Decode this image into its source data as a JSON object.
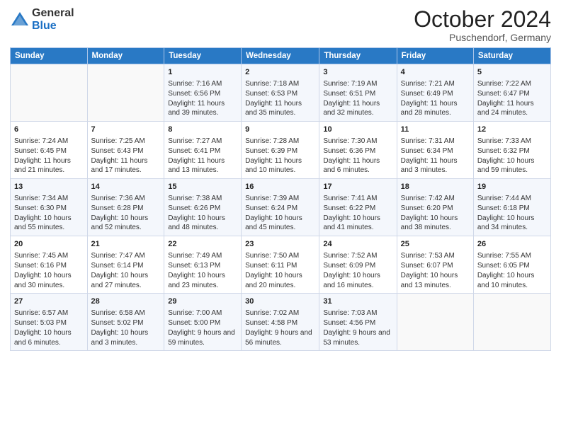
{
  "logo": {
    "general": "General",
    "blue": "Blue"
  },
  "title": "October 2024",
  "location": "Puschendorf, Germany",
  "days_header": [
    "Sunday",
    "Monday",
    "Tuesday",
    "Wednesday",
    "Thursday",
    "Friday",
    "Saturday"
  ],
  "weeks": [
    [
      {
        "day": "",
        "info": ""
      },
      {
        "day": "",
        "info": ""
      },
      {
        "day": "1",
        "info": "Sunrise: 7:16 AM\nSunset: 6:56 PM\nDaylight: 11 hours and 39 minutes."
      },
      {
        "day": "2",
        "info": "Sunrise: 7:18 AM\nSunset: 6:53 PM\nDaylight: 11 hours and 35 minutes."
      },
      {
        "day": "3",
        "info": "Sunrise: 7:19 AM\nSunset: 6:51 PM\nDaylight: 11 hours and 32 minutes."
      },
      {
        "day": "4",
        "info": "Sunrise: 7:21 AM\nSunset: 6:49 PM\nDaylight: 11 hours and 28 minutes."
      },
      {
        "day": "5",
        "info": "Sunrise: 7:22 AM\nSunset: 6:47 PM\nDaylight: 11 hours and 24 minutes."
      }
    ],
    [
      {
        "day": "6",
        "info": "Sunrise: 7:24 AM\nSunset: 6:45 PM\nDaylight: 11 hours and 21 minutes."
      },
      {
        "day": "7",
        "info": "Sunrise: 7:25 AM\nSunset: 6:43 PM\nDaylight: 11 hours and 17 minutes."
      },
      {
        "day": "8",
        "info": "Sunrise: 7:27 AM\nSunset: 6:41 PM\nDaylight: 11 hours and 13 minutes."
      },
      {
        "day": "9",
        "info": "Sunrise: 7:28 AM\nSunset: 6:39 PM\nDaylight: 11 hours and 10 minutes."
      },
      {
        "day": "10",
        "info": "Sunrise: 7:30 AM\nSunset: 6:36 PM\nDaylight: 11 hours and 6 minutes."
      },
      {
        "day": "11",
        "info": "Sunrise: 7:31 AM\nSunset: 6:34 PM\nDaylight: 11 hours and 3 minutes."
      },
      {
        "day": "12",
        "info": "Sunrise: 7:33 AM\nSunset: 6:32 PM\nDaylight: 10 hours and 59 minutes."
      }
    ],
    [
      {
        "day": "13",
        "info": "Sunrise: 7:34 AM\nSunset: 6:30 PM\nDaylight: 10 hours and 55 minutes."
      },
      {
        "day": "14",
        "info": "Sunrise: 7:36 AM\nSunset: 6:28 PM\nDaylight: 10 hours and 52 minutes."
      },
      {
        "day": "15",
        "info": "Sunrise: 7:38 AM\nSunset: 6:26 PM\nDaylight: 10 hours and 48 minutes."
      },
      {
        "day": "16",
        "info": "Sunrise: 7:39 AM\nSunset: 6:24 PM\nDaylight: 10 hours and 45 minutes."
      },
      {
        "day": "17",
        "info": "Sunrise: 7:41 AM\nSunset: 6:22 PM\nDaylight: 10 hours and 41 minutes."
      },
      {
        "day": "18",
        "info": "Sunrise: 7:42 AM\nSunset: 6:20 PM\nDaylight: 10 hours and 38 minutes."
      },
      {
        "day": "19",
        "info": "Sunrise: 7:44 AM\nSunset: 6:18 PM\nDaylight: 10 hours and 34 minutes."
      }
    ],
    [
      {
        "day": "20",
        "info": "Sunrise: 7:45 AM\nSunset: 6:16 PM\nDaylight: 10 hours and 30 minutes."
      },
      {
        "day": "21",
        "info": "Sunrise: 7:47 AM\nSunset: 6:14 PM\nDaylight: 10 hours and 27 minutes."
      },
      {
        "day": "22",
        "info": "Sunrise: 7:49 AM\nSunset: 6:13 PM\nDaylight: 10 hours and 23 minutes."
      },
      {
        "day": "23",
        "info": "Sunrise: 7:50 AM\nSunset: 6:11 PM\nDaylight: 10 hours and 20 minutes."
      },
      {
        "day": "24",
        "info": "Sunrise: 7:52 AM\nSunset: 6:09 PM\nDaylight: 10 hours and 16 minutes."
      },
      {
        "day": "25",
        "info": "Sunrise: 7:53 AM\nSunset: 6:07 PM\nDaylight: 10 hours and 13 minutes."
      },
      {
        "day": "26",
        "info": "Sunrise: 7:55 AM\nSunset: 6:05 PM\nDaylight: 10 hours and 10 minutes."
      }
    ],
    [
      {
        "day": "27",
        "info": "Sunrise: 6:57 AM\nSunset: 5:03 PM\nDaylight: 10 hours and 6 minutes."
      },
      {
        "day": "28",
        "info": "Sunrise: 6:58 AM\nSunset: 5:02 PM\nDaylight: 10 hours and 3 minutes."
      },
      {
        "day": "29",
        "info": "Sunrise: 7:00 AM\nSunset: 5:00 PM\nDaylight: 9 hours and 59 minutes."
      },
      {
        "day": "30",
        "info": "Sunrise: 7:02 AM\nSunset: 4:58 PM\nDaylight: 9 hours and 56 minutes."
      },
      {
        "day": "31",
        "info": "Sunrise: 7:03 AM\nSunset: 4:56 PM\nDaylight: 9 hours and 53 minutes."
      },
      {
        "day": "",
        "info": ""
      },
      {
        "day": "",
        "info": ""
      }
    ]
  ]
}
